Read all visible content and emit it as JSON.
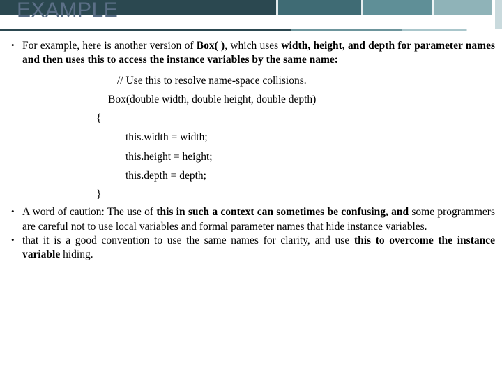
{
  "slide": {
    "title": "EXAMPLE",
    "bullets": [
      {
        "id": "bullet-1",
        "segments": [
          {
            "text": "For example, here is another version of ",
            "bold": false
          },
          {
            "text": "Box( )",
            "bold": true
          },
          {
            "text": ", which uses ",
            "bold": false
          },
          {
            "text": "width, height, and depth for parameter names and then uses this to access the instance variables by the same name:",
            "bold": true
          }
        ]
      }
    ],
    "code": [
      "// Use this to resolve name-space collisions.",
      "Box(double width, double height, double depth)",
      "{",
      "this.width = width;",
      "this.height = height;",
      "this.depth = depth;",
      "}"
    ],
    "bullets_after": [
      {
        "id": "bullet-2",
        "segments": [
          {
            "text": "A word of caution: The use of ",
            "bold": false
          },
          {
            "text": "this in such a context can sometimes be confusing, and",
            "bold": true
          },
          {
            "text": " some programmers are careful not to use local variables and formal parameter names that hide instance variables.",
            "bold": false
          }
        ]
      },
      {
        "id": "bullet-3",
        "segments": [
          {
            "text": "that it is a good convention to use the same names for clarity, and use ",
            "bold": false
          },
          {
            "text": "this to overcome the instance variable",
            "bold": true
          },
          {
            "text": " hiding.",
            "bold": false
          }
        ]
      }
    ]
  },
  "theme": {
    "band_dark": "#2b4850",
    "band_mid": "#3f6b74",
    "band_light": "#8fb3b8",
    "title_color": "#5b6f86",
    "text_color": "#000000"
  }
}
